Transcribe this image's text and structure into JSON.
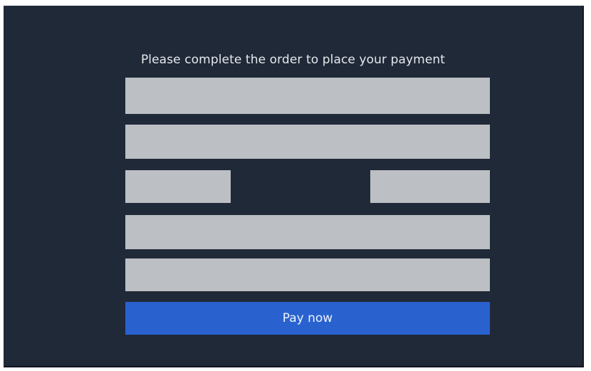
{
  "checkout": {
    "heading": "Please complete the order to place your payment",
    "pay_button_label": "Pay now",
    "fields": {
      "line1": {
        "value": "",
        "placeholder": ""
      },
      "line2": {
        "value": "",
        "placeholder": ""
      },
      "small_left": {
        "value": "",
        "placeholder": ""
      },
      "small_right": {
        "value": "",
        "placeholder": ""
      },
      "line4": {
        "value": "",
        "placeholder": ""
      },
      "line5": {
        "value": "",
        "placeholder": ""
      }
    }
  },
  "colors": {
    "background": "#202938",
    "field": "#bcbfc3",
    "button": "#2962cf",
    "heading_text": "#e6e9ee"
  }
}
